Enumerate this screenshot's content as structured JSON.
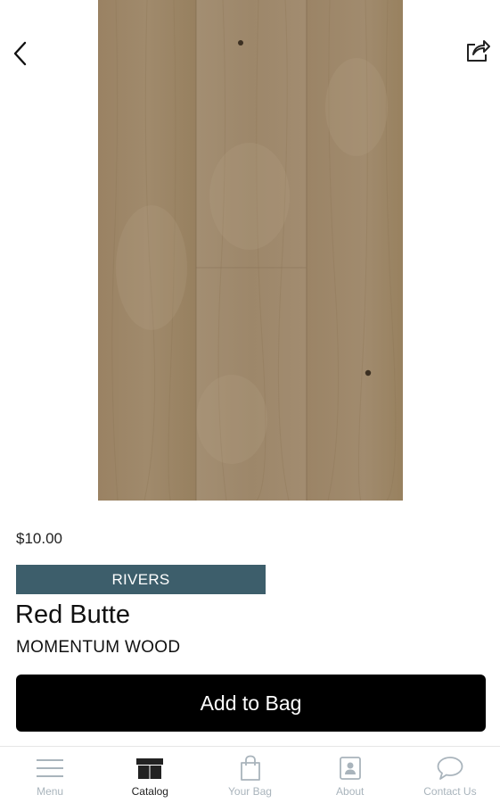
{
  "header": {
    "back_icon": "chevron-left-icon",
    "share_icon": "share-icon"
  },
  "product": {
    "image_icon": "wood-plank-image",
    "price": "$10.00",
    "collection": "RIVERS",
    "name": "Red Butte",
    "line": "MOMENTUM WOOD",
    "add_to_bag_label": "Add to Bag"
  },
  "bottom_nav": {
    "items": [
      {
        "label": "Menu",
        "icon": "hamburger-menu-icon",
        "active": false
      },
      {
        "label": "Catalog",
        "icon": "catalog-box-icon",
        "active": true
      },
      {
        "label": "Your Bag",
        "icon": "shopping-bag-icon",
        "active": false
      },
      {
        "label": "About",
        "icon": "contact-card-icon",
        "active": false
      },
      {
        "label": "Contact Us",
        "icon": "chat-bubble-icon",
        "active": false
      }
    ]
  },
  "colors": {
    "badge_background": "#3d5e6b",
    "button_background": "#000000",
    "nav_inactive": "#a9b4bc",
    "nav_active": "#222222",
    "wood_base": "#9c8567"
  }
}
